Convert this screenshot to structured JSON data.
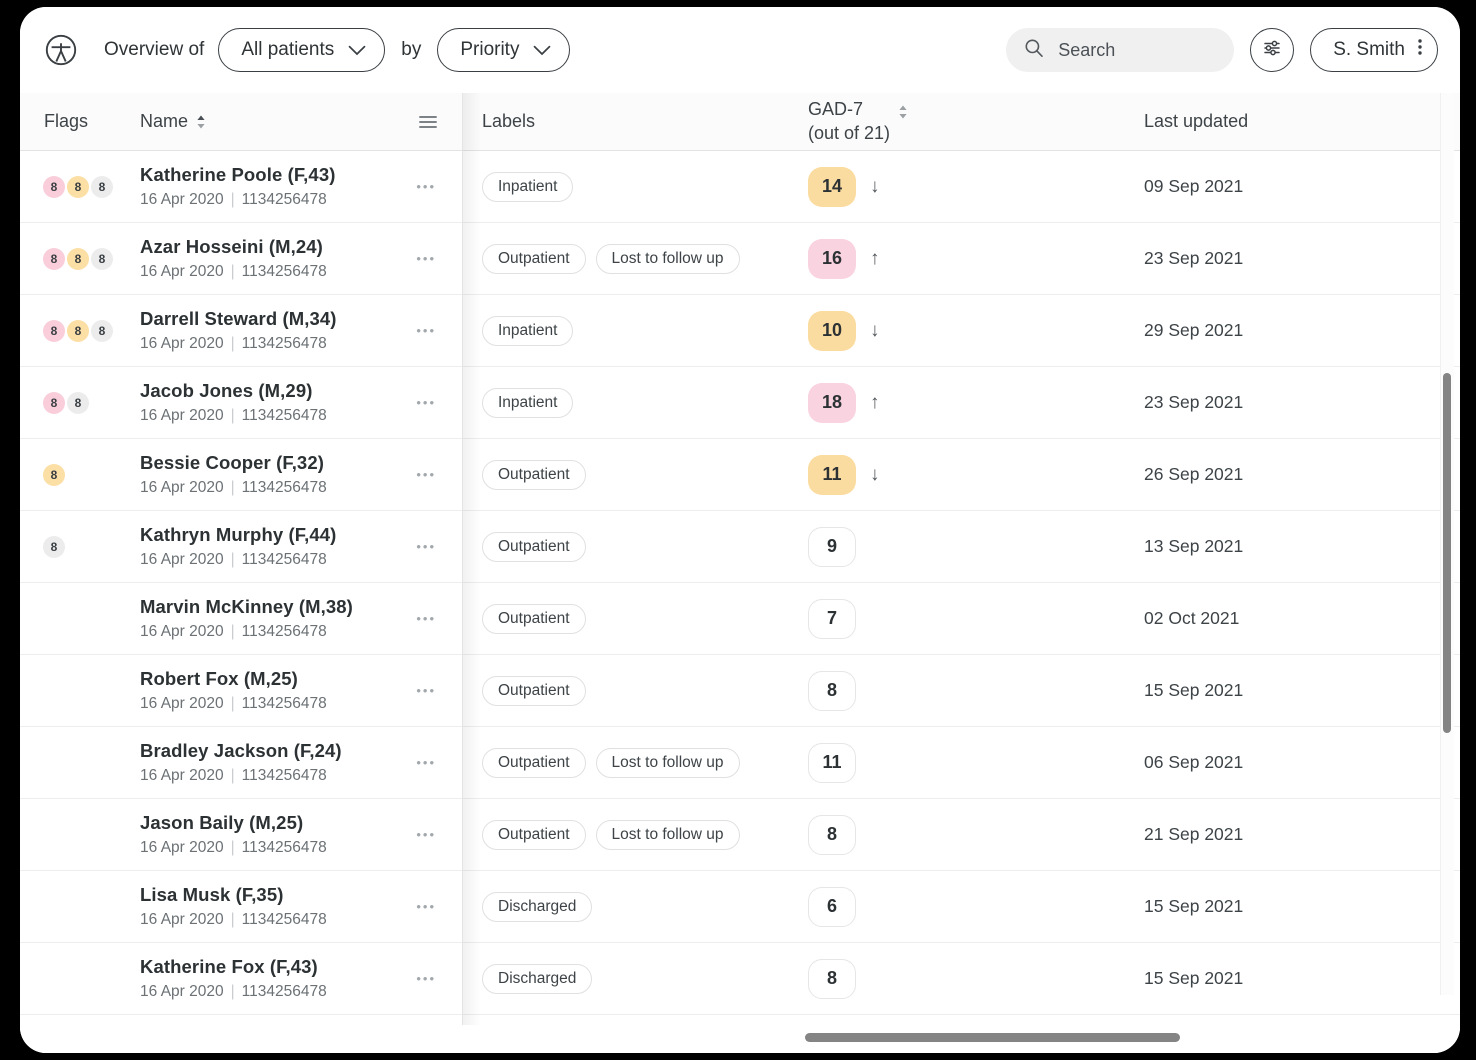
{
  "header": {
    "logo_icon": "patient-circle-logo",
    "overview_prefix": "Overview of",
    "cohort_select": {
      "value": "All patients",
      "icon": "chevron-down-icon"
    },
    "by_label": "by",
    "grouping_select": {
      "value": "Priority",
      "icon": "chevron-down-icon"
    },
    "search": {
      "placeholder": "Search",
      "value": "",
      "icon": "search-icon"
    },
    "filter_button": {
      "icon": "tune-sliders-icon"
    },
    "user": {
      "name": "S. Smith",
      "icon": "kebab-menu-icon"
    }
  },
  "table": {
    "columns": {
      "flags": "Flags",
      "name": "Name",
      "name_sort_icon": "sort-updown-icon",
      "column_menu_icon": "hamburger-menu-icon",
      "labels": "Labels",
      "score_line1": "GAD-7",
      "score_line2": "(out of 21)",
      "score_sort_icon": "sort-updown-icon",
      "updated": "Last updated"
    },
    "flag_colors": {
      "pink": "#F9CEDA",
      "amber": "#FBDFA5",
      "grey": "#ECECEC"
    },
    "score_colors": {
      "amber": "#FBDCA0",
      "pink": "#F9D3DF",
      "plain": "#FFFFFF"
    },
    "rows": [
      {
        "flags": [
          {
            "value": "8",
            "color": "pink"
          },
          {
            "value": "8",
            "color": "amber"
          },
          {
            "value": "8",
            "color": "grey"
          }
        ],
        "name": "Katherine Poole (F,43)",
        "date": "16 Apr 2020",
        "id": "1134256478",
        "more_icon": "more-horizontal-icon",
        "labels": [
          "Inpatient"
        ],
        "score": "14",
        "score_style": "amber",
        "trend": "↓",
        "updated": "09 Sep 2021"
      },
      {
        "flags": [
          {
            "value": "8",
            "color": "pink"
          },
          {
            "value": "8",
            "color": "amber"
          },
          {
            "value": "8",
            "color": "grey"
          }
        ],
        "name": "Azar Hosseini (M,24)",
        "date": "16 Apr 2020",
        "id": "1134256478",
        "more_icon": "more-horizontal-icon",
        "labels": [
          "Outpatient",
          "Lost to follow up"
        ],
        "score": "16",
        "score_style": "pink",
        "trend": "↑",
        "updated": "23 Sep 2021"
      },
      {
        "flags": [
          {
            "value": "8",
            "color": "pink"
          },
          {
            "value": "8",
            "color": "amber"
          },
          {
            "value": "8",
            "color": "grey"
          }
        ],
        "name": "Darrell Steward (M,34)",
        "date": "16 Apr 2020",
        "id": "1134256478",
        "more_icon": "more-horizontal-icon",
        "labels": [
          "Inpatient"
        ],
        "score": "10",
        "score_style": "amber",
        "trend": "↓",
        "updated": "29 Sep 2021"
      },
      {
        "flags": [
          {
            "value": "8",
            "color": "pink"
          },
          {
            "value": "8",
            "color": "grey"
          }
        ],
        "name": "Jacob Jones (M,29)",
        "date": "16 Apr 2020",
        "id": "1134256478",
        "more_icon": "more-horizontal-icon",
        "labels": [
          "Inpatient"
        ],
        "score": "18",
        "score_style": "pink",
        "trend": "↑",
        "updated": "23 Sep 2021"
      },
      {
        "flags": [
          {
            "value": "8",
            "color": "amber"
          }
        ],
        "name": "Bessie Cooper (F,32)",
        "date": "16 Apr 2020",
        "id": "1134256478",
        "more_icon": "more-horizontal-icon",
        "labels": [
          "Outpatient"
        ],
        "score": "11",
        "score_style": "amber",
        "trend": "↓",
        "updated": "26 Sep 2021"
      },
      {
        "flags": [
          {
            "value": "8",
            "color": "grey"
          }
        ],
        "name": "Kathryn Murphy (F,44)",
        "date": "16 Apr 2020",
        "id": "1134256478",
        "more_icon": "more-horizontal-icon",
        "labels": [
          "Outpatient"
        ],
        "score": "9",
        "score_style": "plain",
        "trend": "",
        "updated": "13 Sep 2021"
      },
      {
        "flags": [],
        "name": "Marvin McKinney (M,38)",
        "date": "16 Apr 2020",
        "id": "1134256478",
        "more_icon": "more-horizontal-icon",
        "labels": [
          "Outpatient"
        ],
        "score": "7",
        "score_style": "plain",
        "trend": "",
        "updated": "02 Oct 2021"
      },
      {
        "flags": [],
        "name": "Robert Fox (M,25)",
        "date": "16 Apr 2020",
        "id": "1134256478",
        "more_icon": "more-horizontal-icon",
        "labels": [
          "Outpatient"
        ],
        "score": "8",
        "score_style": "plain",
        "trend": "",
        "updated": "15 Sep 2021"
      },
      {
        "flags": [],
        "name": "Bradley Jackson (F,24)",
        "date": "16 Apr 2020",
        "id": "1134256478",
        "more_icon": "more-horizontal-icon",
        "labels": [
          "Outpatient",
          "Lost to follow up"
        ],
        "score": "11",
        "score_style": "plain",
        "trend": "",
        "updated": "06 Sep 2021"
      },
      {
        "flags": [],
        "name": "Jason Baily (M,25)",
        "date": "16 Apr 2020",
        "id": "1134256478",
        "more_icon": "more-horizontal-icon",
        "labels": [
          "Outpatient",
          "Lost to follow up"
        ],
        "score": "8",
        "score_style": "plain",
        "trend": "",
        "updated": "21 Sep 2021"
      },
      {
        "flags": [],
        "name": "Lisa Musk (F,35)",
        "date": "16 Apr 2020",
        "id": "1134256478",
        "more_icon": "more-horizontal-icon",
        "labels": [
          "Discharged"
        ],
        "score": "6",
        "score_style": "plain",
        "trend": "",
        "updated": "15 Sep 2021"
      },
      {
        "flags": [],
        "name": "Katherine Fox (F,43)",
        "date": "16 Apr 2020",
        "id": "1134256478",
        "more_icon": "more-horizontal-icon",
        "labels": [
          "Discharged"
        ],
        "score": "8",
        "score_style": "plain",
        "trend": "",
        "updated": "15 Sep 2021"
      }
    ]
  }
}
